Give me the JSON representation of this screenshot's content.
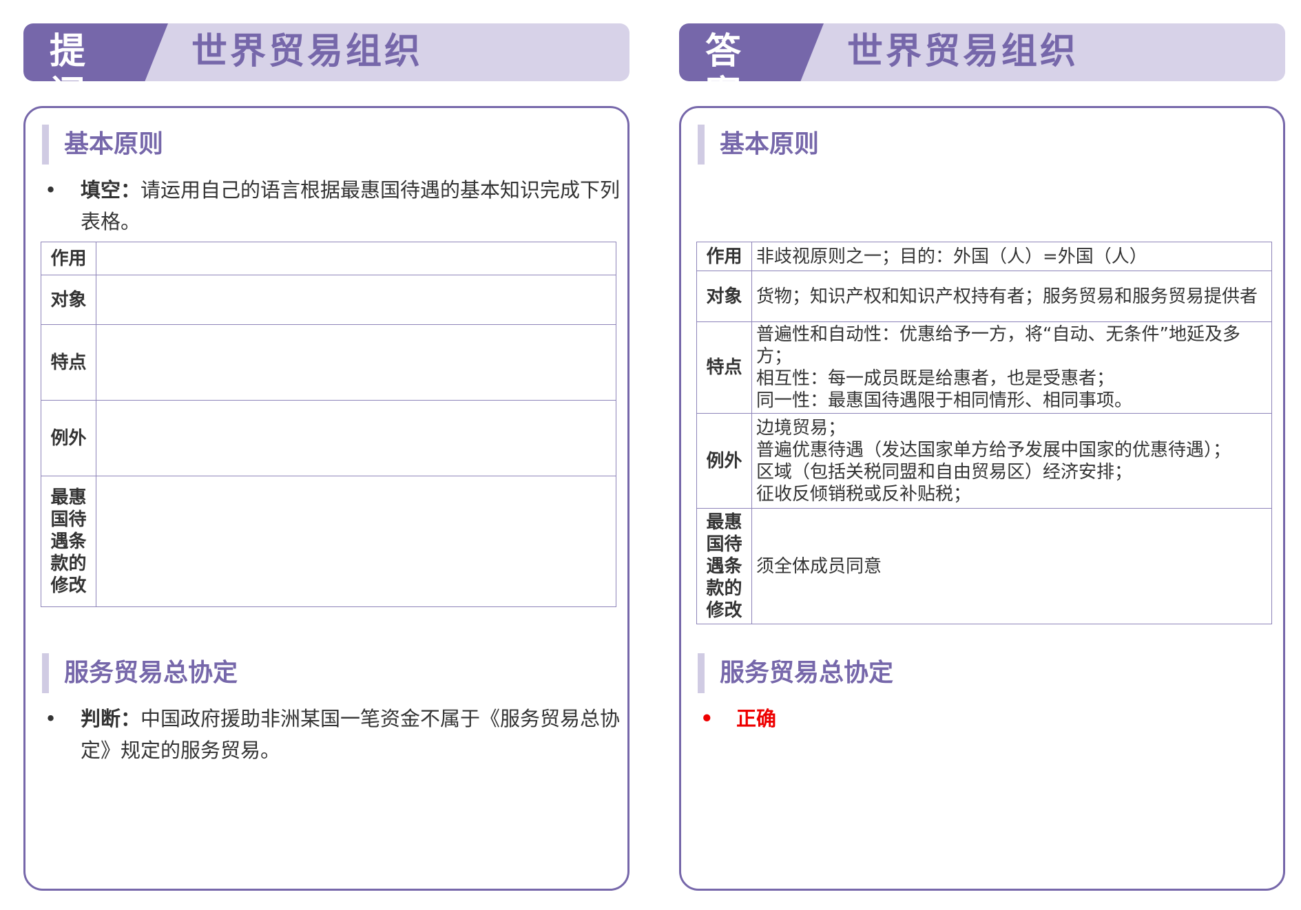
{
  "left": {
    "tag": "提 问",
    "title": "世界贸易组织",
    "section1": {
      "heading": "基本原则",
      "bullet_label": "填空：",
      "bullet_text": "请运用自己的语言根据最惠国待遇的基本知识完成下列表格。"
    },
    "table": {
      "rows": [
        {
          "key": "作用",
          "value": ""
        },
        {
          "key": "对象",
          "value": ""
        },
        {
          "key": "特点",
          "value": ""
        },
        {
          "key": "例外",
          "value": ""
        },
        {
          "key": "最惠国待遇条款的修改",
          "value": ""
        }
      ]
    },
    "section2": {
      "heading": "服务贸易总协定",
      "bullet_label": "判断：",
      "bullet_text": "中国政府援助非洲某国一笔资金不属于《服务贸易总协定》规定的服务贸易。"
    }
  },
  "right": {
    "tag": "答 案",
    "title": "世界贸易组织",
    "section1": {
      "heading": "基本原则"
    },
    "table": {
      "rows": [
        {
          "key": "作用",
          "value": "非歧视原则之一；目的：外国（人）=外国（人）"
        },
        {
          "key": "对象",
          "value": "货物；知识产权和知识产权持有者；服务贸易和服务贸易提供者"
        },
        {
          "key": "特点",
          "value": "普遍性和自动性：优惠给予一方，将“自动、无条件”地延及多方；\n相互性：每一成员既是给惠者，也是受惠者；\n同一性：最惠国待遇限于相同情形、相同事项。"
        },
        {
          "key": "例外",
          "value": "边境贸易；\n普遍优惠待遇（发达国家单方给予发展中国家的优惠待遇）；\n区域（包括关税同盟和自由贸易区）经济安排；\n征收反倾销税或反补贴税；"
        },
        {
          "key": "最惠国待遇条款的修改",
          "value": "须全体成员同意"
        }
      ]
    },
    "section2": {
      "heading": "服务贸易总协定",
      "answer": "正确"
    }
  },
  "bullet_symbol": "•",
  "colors": {
    "accent": "#7667aa",
    "banner_bg": "#d7d2e8",
    "table_border": "#8c82b8",
    "answer_red": "#ee0000"
  }
}
